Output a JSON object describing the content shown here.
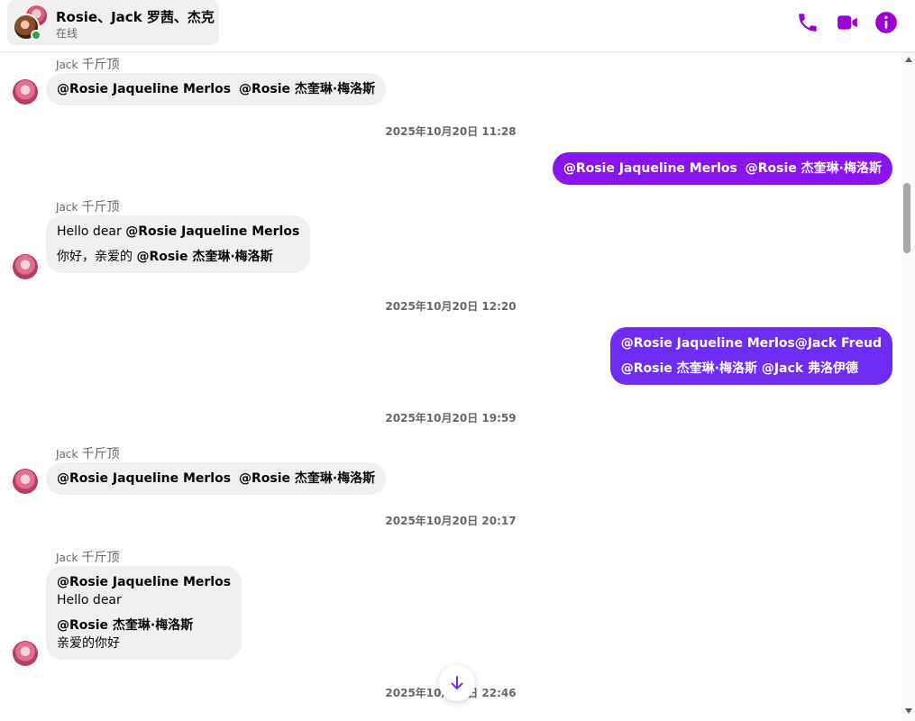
{
  "colors": {
    "accent": "#a000d8",
    "outgoing_bubble_1": "#8a14f0",
    "outgoing_bubble_2": "#6f2cf5",
    "incoming_bubble": "#f0f0f0",
    "online": "#31a24c"
  },
  "header": {
    "title": "Rosie、Jack  罗茜、杰克",
    "status": "在线",
    "icons": [
      "phone-icon",
      "video-camera-icon",
      "info-icon"
    ]
  },
  "messages": [
    {
      "sender": "Jack",
      "nickname": "千斤顶",
      "line1_mention1": "@Rosie Jaqueline Merlos",
      "line1_mention2": "@Rosie 杰奎琳·梅洛斯"
    },
    {
      "timestamp": "2025年10月20日 11:28"
    },
    {
      "outgoing": true,
      "line1_mention1": "@Rosie Jaqueline Merlos",
      "line1_mention2": "@Rosie 杰奎琳·梅洛斯"
    },
    {
      "sender": "Jack",
      "nickname": "千斤顶",
      "line1_text": "Hello dear ",
      "line1_mention": "@Rosie Jaqueline Merlos",
      "line2_text": "你好，亲爱的 ",
      "line2_mention": "@Rosie 杰奎琳·梅洛斯"
    },
    {
      "timestamp": "2025年10月20日 12:20"
    },
    {
      "outgoing": true,
      "line1": "@Rosie Jaqueline Merlos@Jack Freud",
      "line2": "@Rosie 杰奎琳·梅洛斯 @Jack 弗洛伊德"
    },
    {
      "timestamp": "2025年10月20日 19:59"
    },
    {
      "sender": "Jack",
      "nickname": "千斤顶",
      "line1_mention1": "@Rosie Jaqueline Merlos",
      "line1_mention2": "@Rosie 杰奎琳·梅洛斯"
    },
    {
      "timestamp": "2025年10月20日 20:17"
    },
    {
      "sender": "Jack",
      "nickname": "千斤顶",
      "line1": "@Rosie Jaqueline Merlos",
      "line2": "Hello dear",
      "line3": "@Rosie 杰奎琳·梅洛斯",
      "line4": "亲爱的你好"
    },
    {
      "timestamp": "2025年10月20日 22:46"
    }
  ]
}
